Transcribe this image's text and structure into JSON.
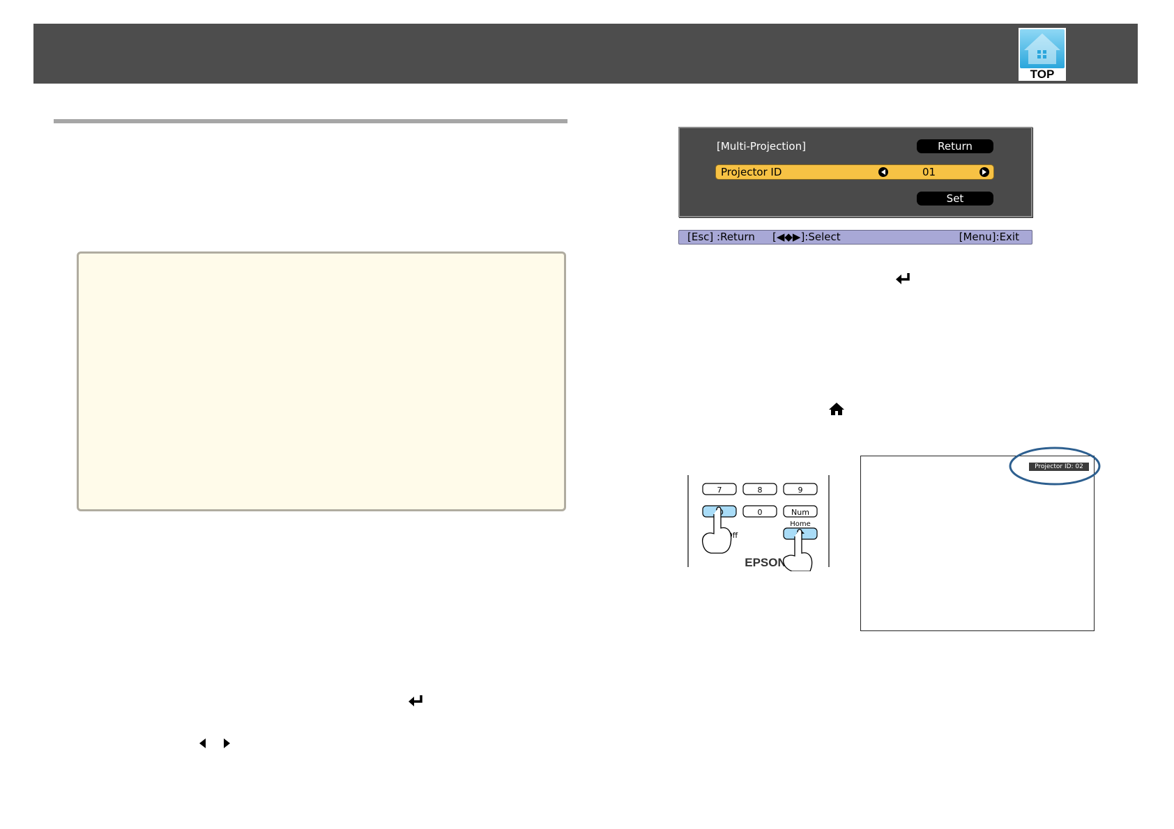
{
  "header": {
    "top_button_label": "TOP"
  },
  "osd": {
    "title": "[Multi-Projection]",
    "return_label": "Return",
    "row_label": "Projector ID",
    "row_value": "01",
    "set_label": "Set"
  },
  "status_bar": {
    "esc": "[Esc] :Return",
    "select": "[◀◆▶]:Select",
    "exit": "[Menu]:Exit"
  },
  "remote": {
    "keys_row1": [
      "7",
      "8",
      "9"
    ],
    "keys_row2": [
      "ID",
      "0",
      "Num"
    ],
    "home_label": "Home",
    "off_label": "Off",
    "brand": "EPSON"
  },
  "projected_screen": {
    "id_label": "Projector ID:  02"
  },
  "colors": {
    "header": "#4d4d4d",
    "osd_highlight": "#f7c244",
    "status_bar": "#a8a8d6",
    "remote_key_active": "#a9dcf7",
    "ellipse": "#2d5f8f"
  }
}
